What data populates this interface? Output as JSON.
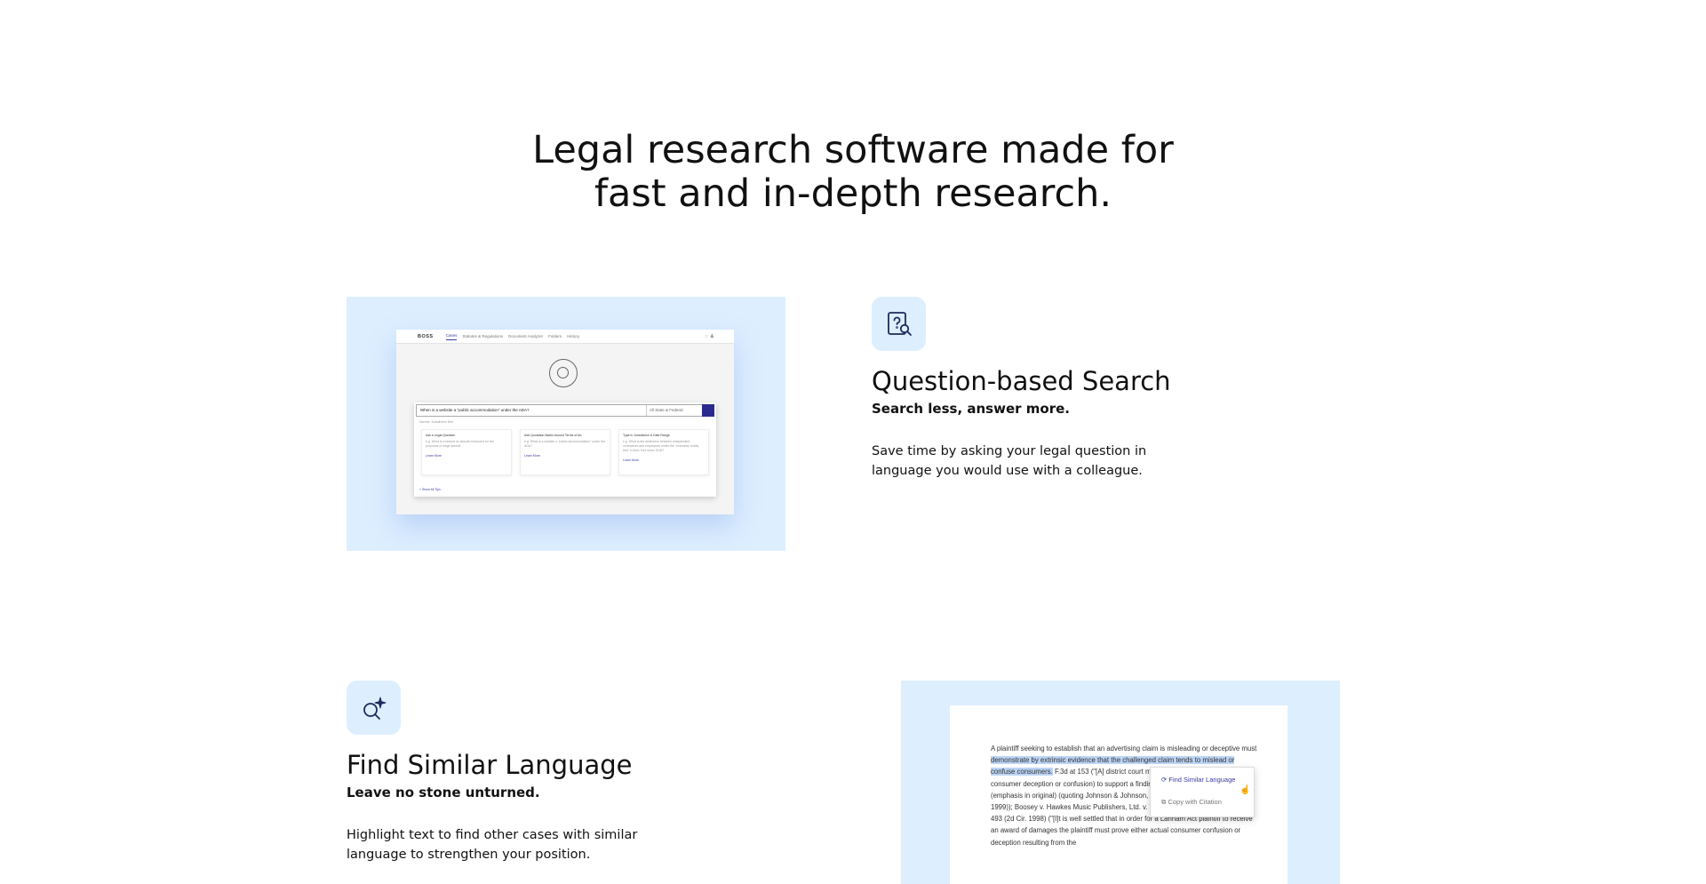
{
  "headline": {
    "line1": "Legal research software made for",
    "line2": "fast and in-depth research."
  },
  "features": [
    {
      "icon": "question-search-icon",
      "title": "Question-based Search",
      "subtitle": "Search less, answer more.",
      "description": "Save time by asking your legal question in language you would use with a colleague."
    },
    {
      "icon": "sparkle-search-icon",
      "title": "Find Similar Language",
      "subtitle": "Leave no stone unturned.",
      "description": "Highlight text to find other cases with similar language to strengthen your position."
    }
  ],
  "mock_app": {
    "logo": "BOSS",
    "tabs": [
      "Cases",
      "Statutes & Regulations",
      "Document Analyzer",
      "Folders",
      "History"
    ],
    "search_value": "When is a website a \"public accommodation\" under the ADA?",
    "jurisdiction": "All State & Federal",
    "hint": "Narrow: Jurisdiction Hint",
    "cards": [
      {
        "title": "Ask a Legal Question",
        "body": "e.g. What is a lawsuit as lawsuit measured for the purposes of wage lawsuit",
        "link": "Learn More"
      },
      {
        "title": "Add Quotation Marks Around Terms of Art",
        "body": "e.g. What is a website a \"public accommodation\" under the ADA?",
        "link": "Learn More"
      },
      {
        "title": "Type in Jurisdiction & Date Range",
        "body": "e.g. What is the distinction between independent contractors and employees under the \"economic reality test\" in New York since 2018?",
        "link": "Learn More"
      }
    ],
    "footer": "+ Show All Tips"
  },
  "mock_doc": {
    "text_before": "A plaintiff seeking to establish that an advertising claim is misleading or deceptive must ",
    "text_highlight": "demonstrate by extrinsic evidence that the challenged claim tends to mislead or confuse consumers.",
    "text_after": " F.3d at 153 (\"[A] district court must rely on extrinsic evidence of consumer deception or confusion) to support a finding of an implicitly false message.\") (emphasis in original) (quoting Johnson & Johnson, Inc., 189 F.3d 218, 229 (2d Cir. 1999)); Boosey v. Hawkes Music Publishers, Ltd. v. Walt Disney Co., 145 F.3d 481, 493 (2d Cir. 1998) (\"[I]t is well settled that in order for a Lanham Act plaintiff to receive an award of damages the plaintiff must prove either actual consumer confusion or deception resulting from the",
    "menu": [
      "Find Similar Language",
      "Copy with Citation"
    ]
  }
}
